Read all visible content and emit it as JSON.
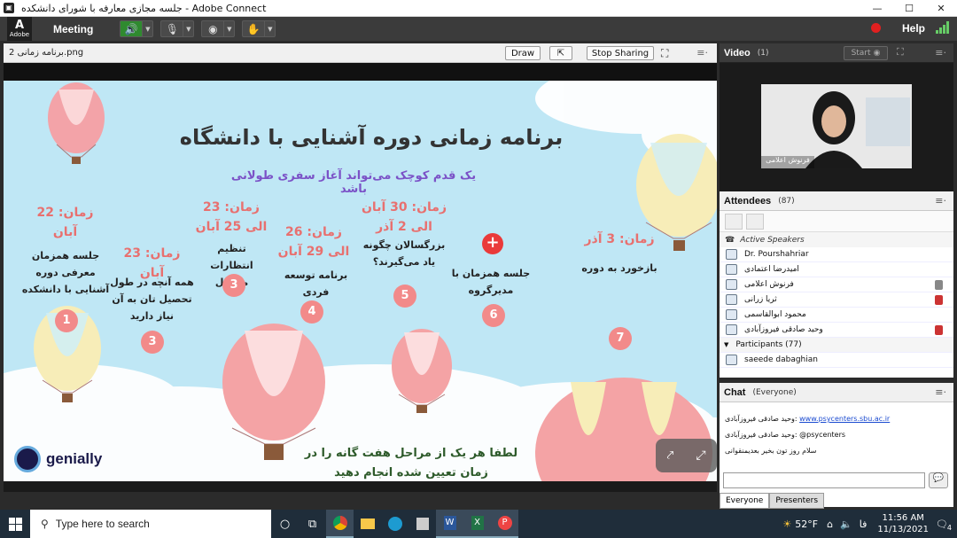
{
  "window": {
    "title": "جلسه مجازی معارفه با شورای دانشکده - Adobe Connect",
    "min": "—",
    "max": "☐",
    "close": "✕"
  },
  "menubar": {
    "logo_text": "Adobe",
    "meeting": "Meeting",
    "help": "Help"
  },
  "share_pod": {
    "filename": "برنامه زمانی 2.png",
    "draw_label": "Draw",
    "stop_sharing_label": "Stop Sharing"
  },
  "slide": {
    "title": "برنامه زمانی دوره آشنایی با دانشگاه",
    "subtitle": "یک قدم کوچک می‌تواند آغاز سفری طولانی باشد",
    "steps": [
      {
        "num": "1",
        "time": "زمان: 22 آبان",
        "text": "جلسه همزمان معرفی دوره آشنایی با دانشکده"
      },
      {
        "num": "2",
        "time": "زمان: 23 آبان",
        "text": "همه آنچه در طول تحصیل تان به آن نیاز دارید"
      },
      {
        "num": "3",
        "time": "زمان: 23 الی 25 آبان",
        "text": "تنظیم انتظارات متقابل"
      },
      {
        "num": "4",
        "time": "زمان: 26 الی 29 آبان",
        "text": "برنامه توسعه فردی"
      },
      {
        "num": "5",
        "time": "زمان: 30 آبان الی 2 آذر",
        "text": "بزرگسالان چگونه یاد می‌گیرند؟"
      },
      {
        "num": "6",
        "time": "+",
        "text": "جلسه همزمان با مدیرگروه"
      },
      {
        "num": "7",
        "time": "زمان: 3 آذر",
        "text": "بازخورد به دوره"
      }
    ],
    "bottom_text": "لطفا هر یک از مراحل هفت گانه را در زمان تعیین شده انجام دهید",
    "brand": "genially"
  },
  "video_pod": {
    "title": "Video",
    "count": "(1)",
    "start_label": "Start",
    "speaker_name": "فرنوش اعلامی"
  },
  "attendees_pod": {
    "title": "Attendees",
    "count": "(87)",
    "active_speakers_label": "Active Speakers",
    "hosts": [
      {
        "name": "Dr. Pourshahriar"
      },
      {
        "name": "امیدرضا اعتمادی"
      },
      {
        "name": "فرنوش اعلامی"
      },
      {
        "name": "ثریا زرانی"
      },
      {
        "name": "محمود ابوالقاسمی"
      },
      {
        "name": "وحید صادقی فیروزآبادی"
      }
    ],
    "participants_label": "Participants (77)",
    "participants": [
      {
        "name": "saeede dabaghian"
      }
    ]
  },
  "chat_pod": {
    "title": "Chat",
    "scope": "(Everyone)",
    "messages": [
      {
        "user": "وحید صادقی فیروزآبادی:",
        "text": "www.psycenters.sbu.ac.ir"
      },
      {
        "user": "وحید صادقی فیروزآبادی:",
        "text": "@psycenters"
      },
      {
        "user": "",
        "text": "سلام روز تون بخیر بعدیمنقوانی"
      }
    ],
    "tab_everyone": "Everyone",
    "tab_presenters": "Presenters"
  },
  "taskbar": {
    "search_placeholder": "Type here to search",
    "temperature": "52°F",
    "lang": "فا",
    "time": "11:56 AM",
    "date": "11/13/2021",
    "notif_count": "4"
  }
}
